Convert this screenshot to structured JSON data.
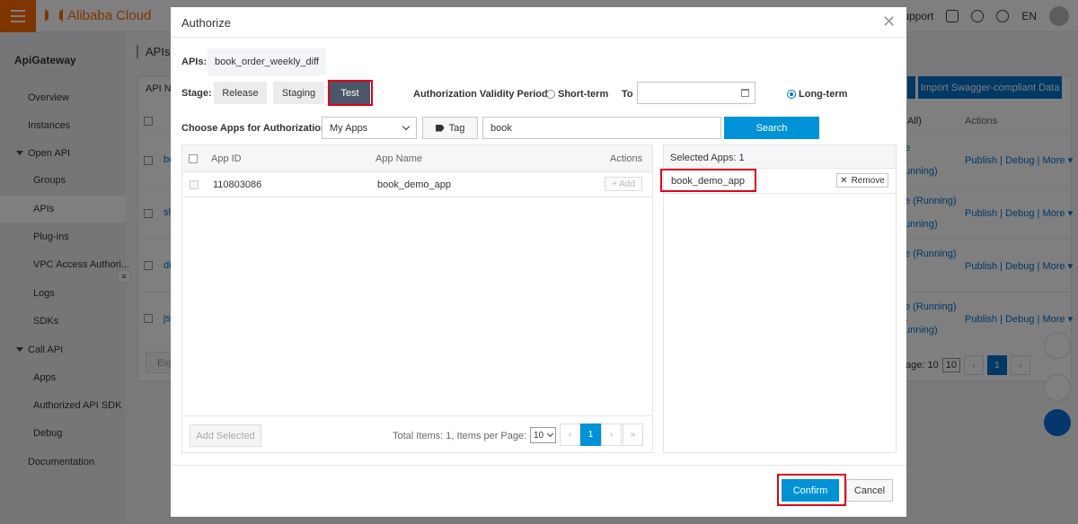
{
  "colors": {
    "brand_orange": "#ff6a00",
    "primary_blue": "#0092d6",
    "active_stage": "#4b5766",
    "highlight_red": "#e0001b"
  },
  "topbar": {
    "logo_text": "Alibaba Cloud",
    "support_label": "Support",
    "language": "EN"
  },
  "sidebar": {
    "title": "ApiGateway",
    "items": [
      {
        "label": "Overview"
      },
      {
        "label": "Instances"
      },
      {
        "label": "Open API"
      },
      {
        "label": "Groups"
      },
      {
        "label": "APIs"
      },
      {
        "label": "Plug-ins"
      },
      {
        "label": "VPC Access Authori..."
      },
      {
        "label": "Logs"
      },
      {
        "label": "SDKs"
      },
      {
        "label": "Call API"
      },
      {
        "label": "Apps"
      },
      {
        "label": "Authorized API SDK"
      },
      {
        "label": "Debug"
      },
      {
        "label": "Documentation"
      }
    ]
  },
  "background": {
    "page_title": "APIs",
    "filter_prefix": "API Na",
    "import_button": "Import Swagger-compliant Data",
    "filter_all": "All)",
    "actions_header": "Actions",
    "row_links": [
      "bo",
      "sh",
      "di",
      "js"
    ],
    "row_status": [
      "e",
      "t",
      "unning)",
      "e (Running)",
      "unning)",
      "e (Running)",
      "l",
      "e (Running)",
      "t",
      "unning)"
    ],
    "row_actions": {
      "publish": "Publish",
      "debug": "Debug",
      "more": "More"
    },
    "export_prefix": "Exp",
    "pager_text": "age: 10",
    "pager_size": "10",
    "pager_current": "1"
  },
  "modal": {
    "title": "Authorize",
    "apis_label": "APIs:",
    "apis_value": "book_order_weekly_diff",
    "stage_label": "Stage:",
    "stages": [
      "Release",
      "Staging",
      "Test"
    ],
    "selected_stage": "Test",
    "validity_label": "Authorization Validity Period:",
    "short_term_label": "Short-term",
    "to_label": "To",
    "date_value": "",
    "long_term_label": "Long-term",
    "validity_selected": "Long-term",
    "choose_apps_label": "Choose Apps for Authorization:",
    "app_filter_value": "My Apps",
    "tag_button": "Tag",
    "search_value": "book",
    "search_button": "Search",
    "table": {
      "columns": [
        "App ID",
        "App Name",
        "Actions"
      ],
      "rows": [
        {
          "app_id": "110803086",
          "app_name": "book_demo_app",
          "action": "+ Add"
        }
      ]
    },
    "add_selected_button": "Add Selected",
    "total_text": "Total Items: 1, Items per Page: 10",
    "page_size_value": "10",
    "pagination": {
      "prev_first": "«",
      "prev": "‹",
      "current": "1",
      "next": "›",
      "next_last": "»"
    },
    "selected_header": "Selected Apps: 1",
    "selected_apps": [
      {
        "name": "book_demo_app",
        "remove_label": "Remove"
      }
    ],
    "confirm_button": "Confirm",
    "cancel_button": "Cancel"
  }
}
